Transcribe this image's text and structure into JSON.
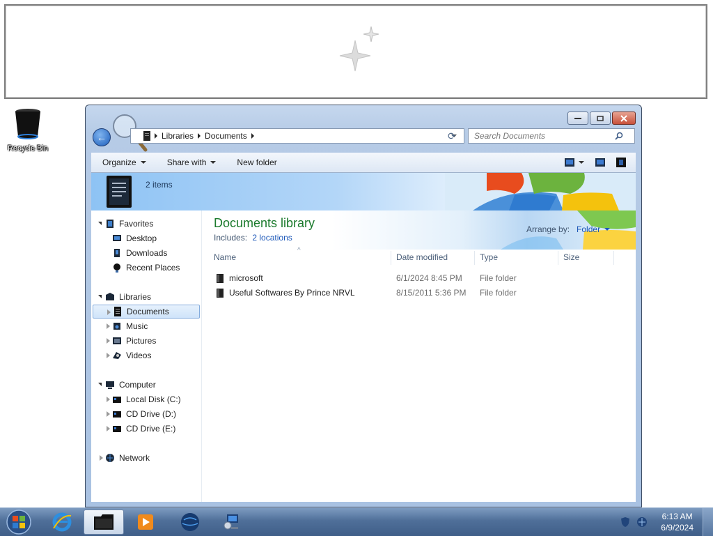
{
  "desktop": {
    "recycle_bin_label": "Recycle Bin"
  },
  "explorer": {
    "address": {
      "segments": [
        "Libraries",
        "Documents"
      ]
    },
    "search": {
      "placeholder": "Search Documents"
    },
    "toolbar": {
      "organize": "Organize",
      "share_with": "Share with",
      "new_folder": "New folder"
    },
    "details": {
      "item_count": "2 items"
    },
    "nav": {
      "favorites": "Favorites",
      "desktop": "Desktop",
      "downloads": "Downloads",
      "recent_places": "Recent Places",
      "libraries": "Libraries",
      "documents": "Documents",
      "music": "Music",
      "pictures": "Pictures",
      "videos": "Videos",
      "computer": "Computer",
      "local_disk": "Local Disk (C:)",
      "cd_drive_d": "CD Drive (D:)",
      "cd_drive_e": "CD Drive (E:)",
      "network": "Network"
    },
    "library": {
      "title": "Documents library",
      "includes_label": "Includes:",
      "locations_link": "2 locations",
      "arrange_by_label": "Arrange by:",
      "arrange_by_value": "Folder"
    },
    "columns": {
      "name": "Name",
      "date_modified": "Date modified",
      "type": "Type",
      "size": "Size"
    },
    "files": [
      {
        "name": "microsoft",
        "date": "6/1/2024 8:45 PM",
        "type": "File folder"
      },
      {
        "name": "Useful Softwares By Prince NRVL",
        "date": "8/15/2011 5:36 PM",
        "type": "File folder"
      }
    ]
  },
  "taskbar": {
    "time": "6:13 AM",
    "date": "6/9/2024"
  }
}
